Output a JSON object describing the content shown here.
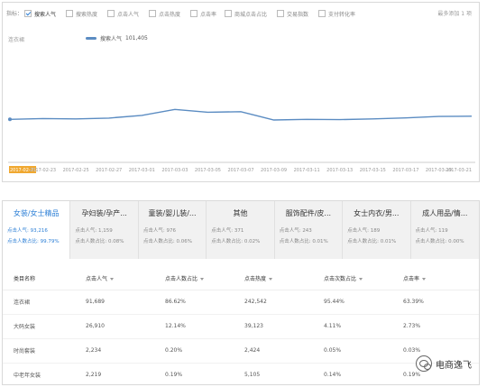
{
  "chart_panel": {
    "metric_label": "指标：",
    "metrics": [
      {
        "label": "搜索人气",
        "checked": true
      },
      {
        "label": "搜索热度",
        "checked": false
      },
      {
        "label": "点击人气",
        "checked": false
      },
      {
        "label": "点击热度",
        "checked": false
      },
      {
        "label": "点击率",
        "checked": false
      },
      {
        "label": "商城点击占比",
        "checked": false
      },
      {
        "label": "交易指数",
        "checked": false
      },
      {
        "label": "支付转化率",
        "checked": false
      }
    ],
    "hint": "最多添加 1 项",
    "series_title": "连衣裙",
    "legend": {
      "name": "搜索人气",
      "value": "101,405"
    },
    "accent": "#5b8cc2"
  },
  "chart_data": {
    "type": "line",
    "x": [
      "2017-02-21",
      "2017-02-23",
      "2017-02-25",
      "2017-02-27",
      "2017-03-01",
      "2017-03-03",
      "2017-03-05",
      "2017-03-07",
      "2017-03-09",
      "2017-03-11",
      "2017-03-13",
      "2017-03-15",
      "2017-03-17",
      "2017-03-19",
      "2017-03-21"
    ],
    "series": [
      {
        "name": "搜索人气",
        "values": [
          90800,
          91500,
          91200,
          92000,
          94500,
          100200,
          97500,
          98000,
          90200,
          90800,
          90500,
          91200,
          92100,
          93500,
          93800
        ]
      }
    ],
    "ylim": [
      50000,
      150000
    ],
    "grid": false,
    "legend": "top-left"
  },
  "tabs": [
    {
      "name": "女装/女士精品",
      "stat1_label": "点击人气",
      "stat1_value": "93,216",
      "stat2_label": "点击人数占比",
      "stat2_value": "99.79%",
      "active": true
    },
    {
      "name": "孕妇装/孕产...",
      "stat1_label": "点击人气",
      "stat1_value": "1,159",
      "stat2_label": "点击人数占比",
      "stat2_value": "0.08%",
      "active": false
    },
    {
      "name": "童装/婴儿装/...",
      "stat1_label": "点击人气",
      "stat1_value": "976",
      "stat2_label": "点击人数占比",
      "stat2_value": "0.06%",
      "active": false
    },
    {
      "name": "其他",
      "stat1_label": "点击人气",
      "stat1_value": "371",
      "stat2_label": "点击人数占比",
      "stat2_value": "0.02%",
      "active": false
    },
    {
      "name": "服饰配件/皮...",
      "stat1_label": "点击人气",
      "stat1_value": "243",
      "stat2_label": "点击人数占比",
      "stat2_value": "0.01%",
      "active": false
    },
    {
      "name": "女士内衣/男...",
      "stat1_label": "点击人气",
      "stat1_value": "189",
      "stat2_label": "点击人数占比",
      "stat2_value": "0.01%",
      "active": false
    },
    {
      "name": "成人用品/情...",
      "stat1_label": "点击人气",
      "stat1_value": "119",
      "stat2_label": "点击人数占比",
      "stat2_value": "0.00%",
      "active": false
    }
  ],
  "table": {
    "headers": [
      "类目名称",
      "点击人气",
      "点击人数占比",
      "点击热度",
      "点击次数占比",
      "点击率"
    ],
    "rows": [
      [
        "连衣裙",
        "91,689",
        "86.62%",
        "242,542",
        "95.44%",
        "63.39%"
      ],
      [
        "大码女装",
        "26,910",
        "12.14%",
        "39,123",
        "4.11%",
        "2.73%"
      ],
      [
        "时尚套装",
        "2,234",
        "0.20%",
        "2,424",
        "0.05%",
        "0.03%"
      ],
      [
        "中老年女装",
        "2,219",
        "0.19%",
        "5,105",
        "0.14%",
        "0.19%"
      ]
    ]
  },
  "watermark": "电商逸飞"
}
